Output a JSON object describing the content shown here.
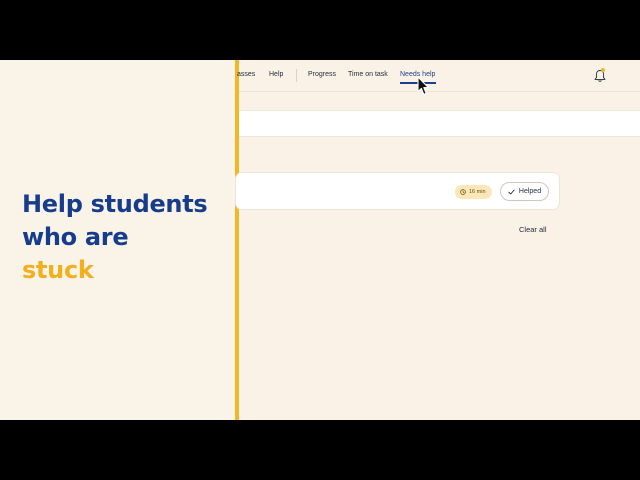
{
  "promo": {
    "line1": "Help students",
    "line2": "who are",
    "line3": "stuck"
  },
  "nav": {
    "items": [
      {
        "label": "asses"
      },
      {
        "label": "Help"
      },
      {
        "label": "Progress"
      },
      {
        "label": "Time on task"
      },
      {
        "label": "Needs help"
      }
    ],
    "active": "Needs help",
    "notification_icon": "bell-icon"
  },
  "request": {
    "time": "16 min",
    "helped_label": "Helped"
  },
  "actions": {
    "clear_all": "Clear all"
  },
  "colors": {
    "brand_blue": "#163c8c",
    "accent_yellow": "#f2b724",
    "background": "#faf2e6"
  }
}
